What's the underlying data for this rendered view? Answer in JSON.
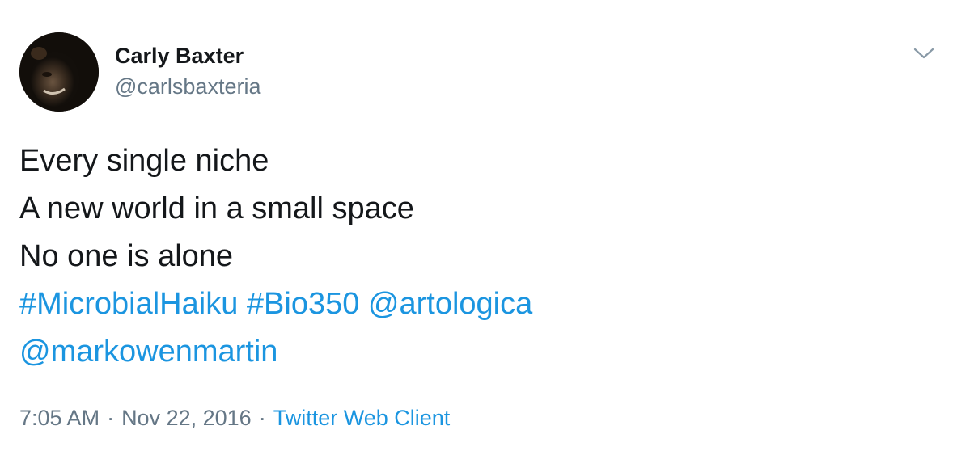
{
  "tweet": {
    "author": {
      "display_name": "Carly Baxter",
      "handle": "@carlsbaxteria"
    },
    "lines": [
      "Every single niche",
      "A new world in a small space",
      "No one is alone"
    ],
    "links": {
      "hashtag_1": "#MicrobialHaiku",
      "hashtag_2": "#Bio350",
      "mention_1": "@artologica",
      "mention_2": "@markowenmartin"
    },
    "meta": {
      "time": "7:05 AM",
      "separator": "·",
      "date": "Nov 22, 2016",
      "source": "Twitter Web Client"
    }
  },
  "icons": {
    "menu": "chevron-down-icon",
    "avatar": "avatar"
  },
  "colors": {
    "text": "#14171a",
    "secondary": "#657786",
    "link": "#1b95e0",
    "divider": "#e6ecf0"
  }
}
